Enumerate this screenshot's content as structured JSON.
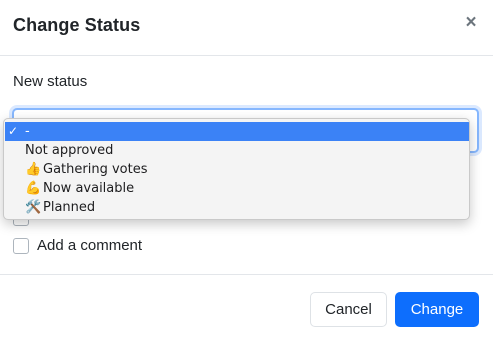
{
  "modal": {
    "title": "Change Status",
    "close_symbol": "×",
    "close_icon": "close-icon"
  },
  "status_field": {
    "label": "New status",
    "selected_value": "-",
    "options": [
      {
        "label": "-",
        "emoji": "",
        "selected": true
      },
      {
        "label": "Not approved",
        "emoji": "",
        "selected": false
      },
      {
        "label": "Gathering votes",
        "emoji": "👍",
        "selected": false
      },
      {
        "label": "Now available",
        "emoji": "💪",
        "selected": false
      },
      {
        "label": "Planned",
        "emoji": "🛠️",
        "selected": false
      }
    ],
    "check_symbol": "✓"
  },
  "options_checkboxes": {
    "hidden_label": "",
    "comment_label": "Add a comment",
    "comment_checked": false
  },
  "footer": {
    "cancel_label": "Cancel",
    "change_label": "Change"
  },
  "colors": {
    "primary": "#0d6efd",
    "selected_option": "#3b82f6",
    "focus_border": "#86b7fe"
  }
}
